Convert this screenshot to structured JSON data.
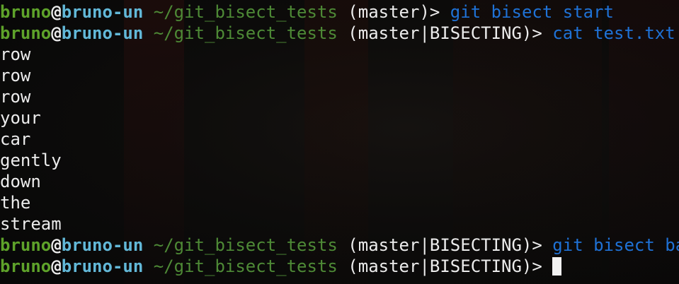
{
  "prompt": {
    "user": "bruno",
    "at": "@",
    "host": "bruno-un",
    "path": "~/git_bisect_tests",
    "branch_master": "(master)>",
    "branch_bisecting": "(master|BISECTING)>"
  },
  "commands": {
    "first": "git bisect start",
    "second": "cat test.txt",
    "third": "git bisect bad"
  },
  "output_lines": [
    "row",
    "row",
    "row",
    "your",
    "car",
    "gently",
    "down",
    "the",
    "stream"
  ],
  "colors": {
    "user": "#5ea22a",
    "host": "#62b8d8",
    "path": "#4e8a36",
    "command": "#1f72d6",
    "text": "#ececec",
    "background": "#0b0b0b"
  }
}
